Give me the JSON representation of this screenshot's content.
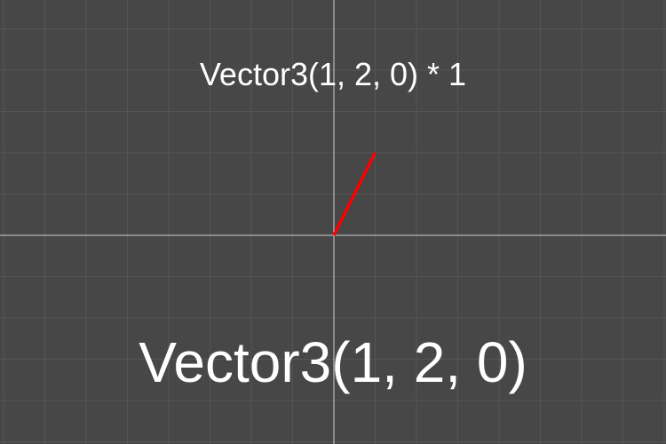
{
  "scene": {
    "expression_label": "Vector3(1, 2, 0) * 1",
    "vector_label": "Vector3(1, 2, 0)",
    "vector": {
      "x": 1,
      "y": 2,
      "z": 0
    },
    "scale": 1,
    "colors": {
      "background": "#474747",
      "grid_line": "#555555",
      "axis_line": "#cfcfcf",
      "vector": "#ff0000",
      "text": "#ffffff"
    }
  }
}
